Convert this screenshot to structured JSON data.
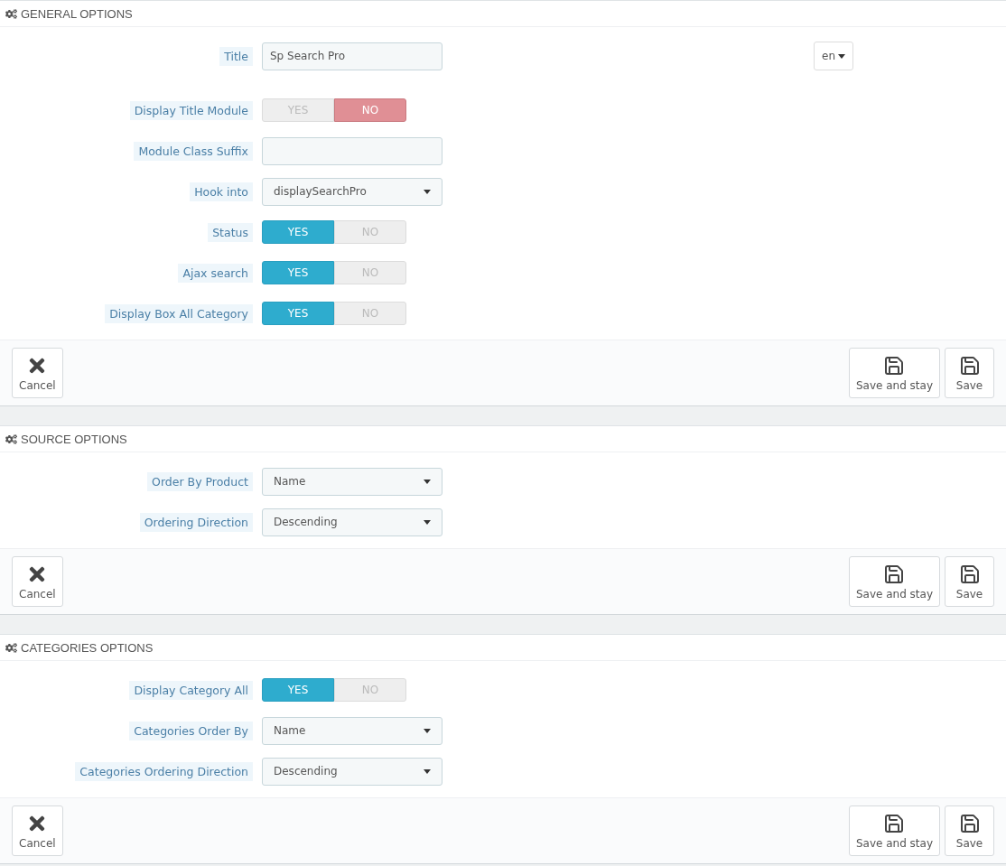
{
  "panels": [
    {
      "title": "GENERAL OPTIONS",
      "fields": [
        {
          "kind": "text",
          "label": "Title",
          "value": "Sp Search Pro",
          "language": "en"
        },
        {
          "kind": "switch",
          "label": "Display Title Module",
          "options": [
            {
              "label": "YES",
              "selected": false
            },
            {
              "label": "NO",
              "selected": true
            }
          ]
        },
        {
          "kind": "text",
          "label": "Module Class Suffix"
        },
        {
          "kind": "select",
          "label": "Hook into",
          "value": "displaySearchPro"
        },
        {
          "kind": "switch",
          "label": "Status",
          "options": [
            {
              "label": "YES",
              "selected": true
            },
            {
              "label": "NO",
              "selected": false
            }
          ]
        },
        {
          "kind": "switch",
          "label": "Ajax search",
          "options": [
            {
              "label": "YES",
              "selected": true
            },
            {
              "label": "NO",
              "selected": false
            }
          ]
        },
        {
          "kind": "switch",
          "label": "Display Box All Category",
          "options": [
            {
              "label": "YES",
              "selected": true
            },
            {
              "label": "NO",
              "selected": false
            }
          ]
        }
      ],
      "buttons": {
        "cancel": "Cancel",
        "save_and_stay": "Save and stay",
        "save": "Save"
      }
    },
    {
      "title": "SOURCE OPTIONS",
      "fields": [
        {
          "kind": "select",
          "label": "Order By Product",
          "value": "Name"
        },
        {
          "kind": "select",
          "label": "Ordering Direction",
          "value": "Descending"
        }
      ],
      "buttons": {
        "cancel": "Cancel",
        "save_and_stay": "Save and stay",
        "save": "Save"
      }
    },
    {
      "title": "CATEGORIES OPTIONS",
      "fields": [
        {
          "kind": "switch",
          "label": "Display Category All",
          "options": [
            {
              "label": "YES",
              "selected": true
            },
            {
              "label": "NO",
              "selected": false
            }
          ]
        },
        {
          "kind": "select",
          "label": "Categories Order By",
          "value": "Name"
        },
        {
          "kind": "select",
          "label": "Categories Ordering Direction",
          "value": "Descending"
        }
      ],
      "buttons": {
        "cancel": "Cancel",
        "save_and_stay": "Save and stay",
        "save": "Save"
      }
    }
  ]
}
